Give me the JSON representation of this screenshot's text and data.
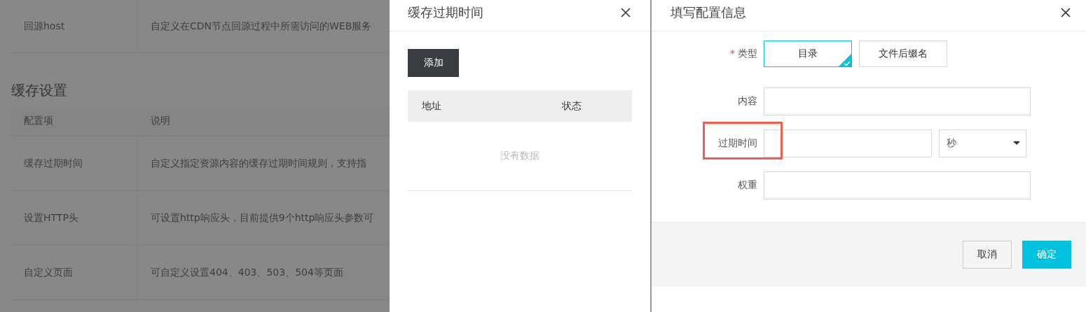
{
  "background_page": {
    "top_row": {
      "item": "回源host",
      "description": "自定义在CDN节点回源过程中所需访问的WEB服务"
    },
    "section_title": "缓存设置",
    "table": {
      "columns": [
        "配置项",
        "说明"
      ],
      "rows": [
        {
          "item": "缓存过期时间",
          "description": "自定义指定资源内容的缓存过期时间规则，支持指"
        },
        {
          "item": "设置HTTP头",
          "description": "可设置http响应头，目前提供9个http响应头参数可"
        },
        {
          "item": "自定义页面",
          "description": "可自定义设置404、403、503、504等页面"
        }
      ]
    }
  },
  "cache_panel": {
    "title": "缓存过期时间",
    "add_button": "添加",
    "table": {
      "columns": [
        "地址",
        "状态"
      ],
      "empty_text": "没有数据"
    }
  },
  "config_panel": {
    "title": "填写配置信息",
    "type_field": {
      "label": "类型",
      "required_mark": "*",
      "options": [
        {
          "label": "目录",
          "selected": true
        },
        {
          "label": "文件后缀名",
          "selected": false
        }
      ]
    },
    "fields": [
      {
        "kind": "text",
        "label": "内容",
        "highlighted": false
      },
      {
        "kind": "text_unit",
        "label": "过期时间",
        "unit": "秒",
        "highlighted": true
      },
      {
        "kind": "text",
        "label": "权重",
        "highlighted": false
      }
    ],
    "buttons": [
      {
        "label": "取消",
        "primary": false
      },
      {
        "label": "确定",
        "primary": true
      }
    ]
  }
}
